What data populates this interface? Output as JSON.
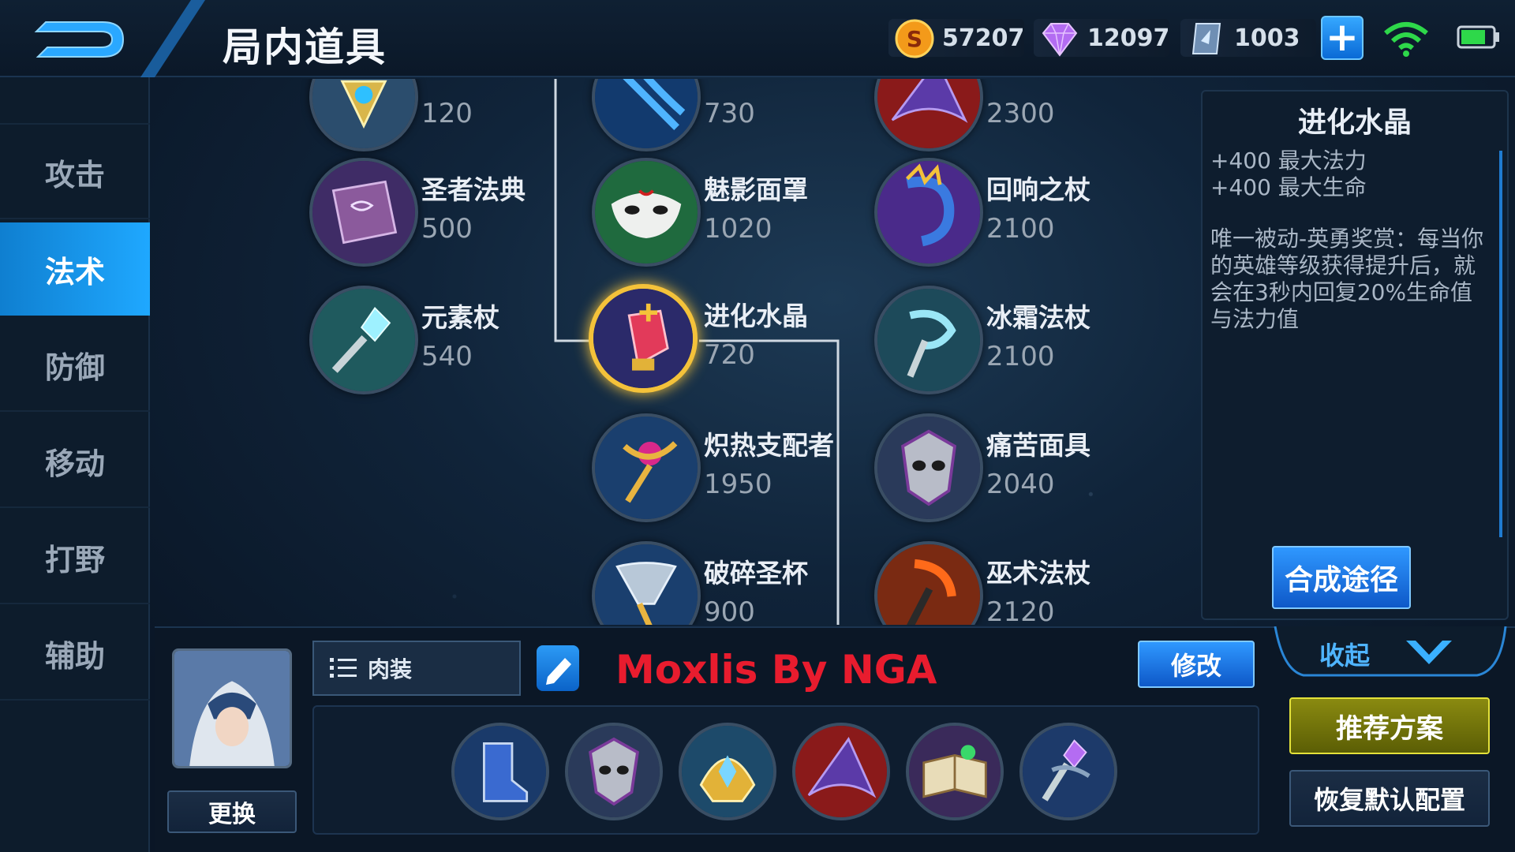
{
  "header": {
    "title": "局内道具",
    "currencies": [
      {
        "name": "gold-coin-icon",
        "value": "57207"
      },
      {
        "name": "diamond-icon",
        "value": "12097"
      },
      {
        "name": "voucher-icon",
        "value": "1003"
      }
    ]
  },
  "sidebar": {
    "items": [
      {
        "label": "攻击"
      },
      {
        "label": "法术"
      },
      {
        "label": "防御"
      },
      {
        "label": "移动"
      },
      {
        "label": "打野"
      },
      {
        "label": "辅助"
      }
    ],
    "active": "法术"
  },
  "items": {
    "c1": [
      {
        "name": "",
        "price": "120",
        "icon": "blue-amulet-icon"
      },
      {
        "name": "圣者法典",
        "price": "500",
        "icon": "spellbook-icon"
      },
      {
        "name": "元素杖",
        "price": "540",
        "icon": "crystal-wand-icon"
      }
    ],
    "c2": [
      {
        "name": "",
        "price": "730",
        "icon": "blue-claw-icon"
      },
      {
        "name": "魅影面罩",
        "price": "1020",
        "icon": "white-mask-icon"
      },
      {
        "name": "进化水晶",
        "price": "720",
        "icon": "red-crystal-icon"
      },
      {
        "name": "炽热支配者",
        "price": "1950",
        "icon": "golden-scepter-icon"
      },
      {
        "name": "破碎圣杯",
        "price": "900",
        "icon": "broken-chalice-icon"
      }
    ],
    "c3": [
      {
        "name": "",
        "price": "2300",
        "icon": "wizard-hat-icon"
      },
      {
        "name": "回响之杖",
        "price": "2100",
        "icon": "dragon-staff-icon"
      },
      {
        "name": "冰霜法杖",
        "price": "2100",
        "icon": "frost-staff-icon"
      },
      {
        "name": "痛苦面具",
        "price": "2040",
        "icon": "torment-mask-icon"
      },
      {
        "name": "巫术法杖",
        "price": "2120",
        "icon": "sorcery-staff-icon"
      }
    ]
  },
  "detail": {
    "title": "进化水晶",
    "stats": [
      "+400 最大法力",
      "+400 最大生命"
    ],
    "description": "唯一被动-英勇奖赏：每当你的英雄等级获得提升后，就会在3秒内回复20%生命值与法力值",
    "craft_button": "合成途径"
  },
  "build": {
    "change_button": "更换",
    "name": "肉装",
    "watermark": "Moxlis By NGA",
    "edit_button": "修改",
    "slots": [
      "boots-icon",
      "torment-mask-icon",
      "golden-helm-icon",
      "wizard-hat-icon",
      "spellbook-icon",
      "purple-staff-icon"
    ]
  },
  "controls": {
    "collapse": "收起",
    "recommend": "推荐方案",
    "reset": "恢复默认配置"
  }
}
